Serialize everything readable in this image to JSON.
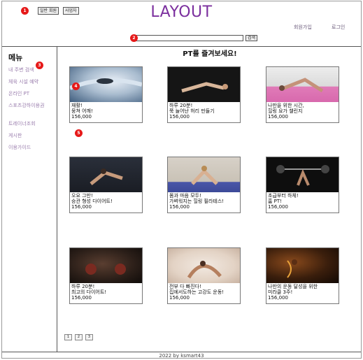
{
  "header": {
    "member_btn": "일반 회원",
    "business_btn": "사업자",
    "logo": "LAYOUT",
    "signup": "회원가입",
    "login": "로그인",
    "search_placeholder": "",
    "search_btn": "검색"
  },
  "markers": [
    "1",
    "2",
    "3",
    "4",
    "5"
  ],
  "sidebar": {
    "title": "메뉴",
    "items": [
      {
        "label": "내 주변 검색"
      },
      {
        "label": "체육 시설 예약"
      },
      {
        "label": "온라인 PT"
      },
      {
        "label": "스포츠강하이용권"
      },
      {
        "label": "트레이너조회"
      },
      {
        "label": "게시판"
      },
      {
        "label": "이용가이드"
      }
    ]
  },
  "main": {
    "title": "PT를 즐겨보세요!",
    "cards": [
      {
        "line1": "재활!",
        "line2": "뭉쳐 어깨!",
        "price": "156,000"
      },
      {
        "line1": "하루 20분!",
        "line2": "쭉 늘어난 허리 만들기",
        "price": "156,000"
      },
      {
        "line1": "나만을 위한 시간,",
        "line2": "힐링 요가 챌린지",
        "price": "156,000"
      },
      {
        "line1": "오요 그만!",
        "line2": "승관 형성 다이어트!",
        "price": "156,000"
      },
      {
        "line1": "몸과 마음 모두!",
        "line2": "가벼워지는 힐링 필라테스!",
        "price": "156,000"
      },
      {
        "line1": "초급부터 하체!",
        "line2": "홈 PT!",
        "price": "156,000"
      },
      {
        "line1": "하루 20분!",
        "line2": "최고의 다이어트!",
        "price": "156,000"
      },
      {
        "line1": "전부 다 빠진다!",
        "line2": "집에서도하는 고강도 운동!",
        "price": "156,000"
      },
      {
        "line1": "나만의 운동 달성을 위한",
        "line2": "미라클 3주!",
        "price": "156,000"
      }
    ]
  },
  "pagination": [
    "1",
    "2",
    "3"
  ],
  "footer": "2022 by ksmart43"
}
